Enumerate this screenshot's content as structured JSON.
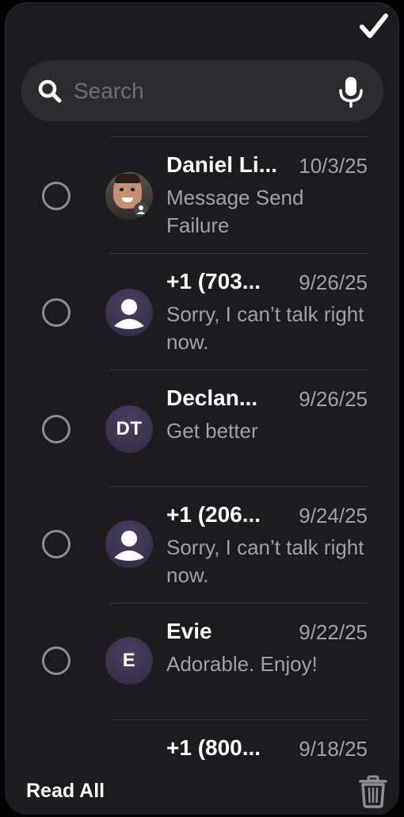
{
  "header": {
    "done_icon": "checkmark-icon"
  },
  "search": {
    "placeholder": "Search",
    "value": ""
  },
  "conversations": [
    {
      "name": "Daniel Li...",
      "date": "10/3/25",
      "preview": "Message Send Failure",
      "avatar": "photo"
    },
    {
      "name": "+1 (703...",
      "date": "9/26/25",
      "preview": "Sorry, I can’t talk right now.",
      "avatar": "person-icon"
    },
    {
      "name": "Declan...",
      "date": "9/26/25",
      "preview": "Get better",
      "avatar": "initials",
      "initials": "DT"
    },
    {
      "name": "+1 (206...",
      "date": "9/24/25",
      "preview": "Sorry, I can’t talk right now.",
      "avatar": "person-icon"
    },
    {
      "name": "Evie",
      "date": "9/22/25",
      "preview": "Adorable. Enjoy!",
      "avatar": "initials",
      "initials": "E"
    },
    {
      "name": "+1 (800...",
      "date": "9/18/25",
      "preview": "",
      "avatar": "person-icon"
    }
  ],
  "footer": {
    "read_all_label": "Read All",
    "trash_icon": "trash-icon"
  },
  "colors": {
    "background": "#1c1c1e",
    "secondary_text": "#a1a1a6",
    "search_bg": "#2c2c2e",
    "avatar_bg": "#3a3350"
  }
}
